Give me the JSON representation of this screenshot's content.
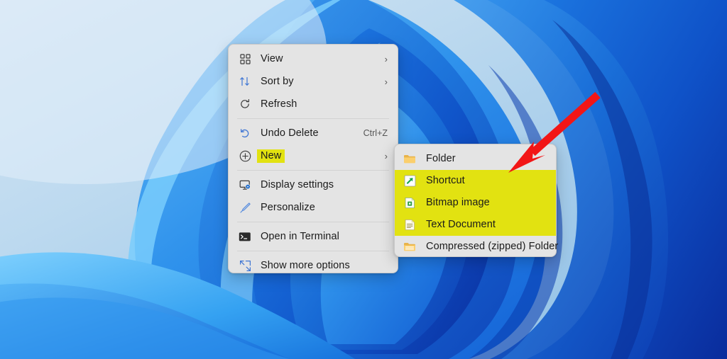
{
  "desktop": {
    "wallpaper_name": "windows-11-bloom-wallpaper",
    "colors": {
      "sky_light": "#cfe2f3",
      "sky_mid": "#a6cdea",
      "sky_deep": "#7fb6e2",
      "ribbon_light": "#4aa8f0",
      "ribbon_mid": "#1a7fe0",
      "ribbon_deep": "#0b4fc4",
      "ribbon_darkest": "#0a2fa8",
      "ribbon_cyan": "#6ec8fb"
    }
  },
  "context_menu": {
    "name": "desktop-context-menu",
    "background": "#e4e4e4",
    "groups": [
      {
        "items": [
          {
            "label": "View",
            "icon": "grid-view-icon",
            "chevron": "›",
            "accel": "",
            "highlighted": false
          },
          {
            "label": "Sort by",
            "icon": "sort-arrows-icon",
            "chevron": "›",
            "accel": "",
            "highlighted": false
          },
          {
            "label": "Refresh",
            "icon": "refresh-icon",
            "chevron": "",
            "accel": "",
            "highlighted": false
          }
        ]
      },
      {
        "items": [
          {
            "label": "Undo Delete",
            "icon": "undo-icon",
            "chevron": "",
            "accel": "Ctrl+Z",
            "highlighted": false
          },
          {
            "label": "New",
            "icon": "plus-circle-icon",
            "chevron": "›",
            "accel": "",
            "highlighted": true
          }
        ]
      },
      {
        "items": [
          {
            "label": "Display settings",
            "icon": "monitor-settings-icon",
            "chevron": "",
            "accel": "",
            "highlighted": false
          },
          {
            "label": "Personalize",
            "icon": "paintbrush-icon",
            "chevron": "",
            "accel": "",
            "highlighted": false
          }
        ]
      },
      {
        "items": [
          {
            "label": "Open in Terminal",
            "icon": "terminal-icon",
            "chevron": "",
            "accel": "",
            "highlighted": false
          }
        ]
      },
      {
        "items": [
          {
            "label": "Show more options",
            "icon": "expand-options-icon",
            "chevron": "",
            "accel": "",
            "highlighted": false
          }
        ]
      }
    ]
  },
  "submenu": {
    "name": "new-submenu",
    "parent_item": "New",
    "highlight_color": "#e2e211",
    "items": [
      {
        "label": "Folder",
        "icon": "folder-icon",
        "marked": false
      },
      {
        "label": "Shortcut",
        "icon": "shortcut-arrow-icon",
        "marked": true
      },
      {
        "label": "Bitmap image",
        "icon": "bitmap-image-icon",
        "marked": true
      },
      {
        "label": "Text Document",
        "icon": "text-document-icon",
        "marked": true
      },
      {
        "label": "Compressed (zipped) Folder",
        "icon": "zipped-folder-icon",
        "marked": false
      }
    ]
  },
  "annotation": {
    "name": "red-pointer-arrow",
    "color": "#f21616",
    "points_to": "new-submenu-top-right-corner"
  }
}
